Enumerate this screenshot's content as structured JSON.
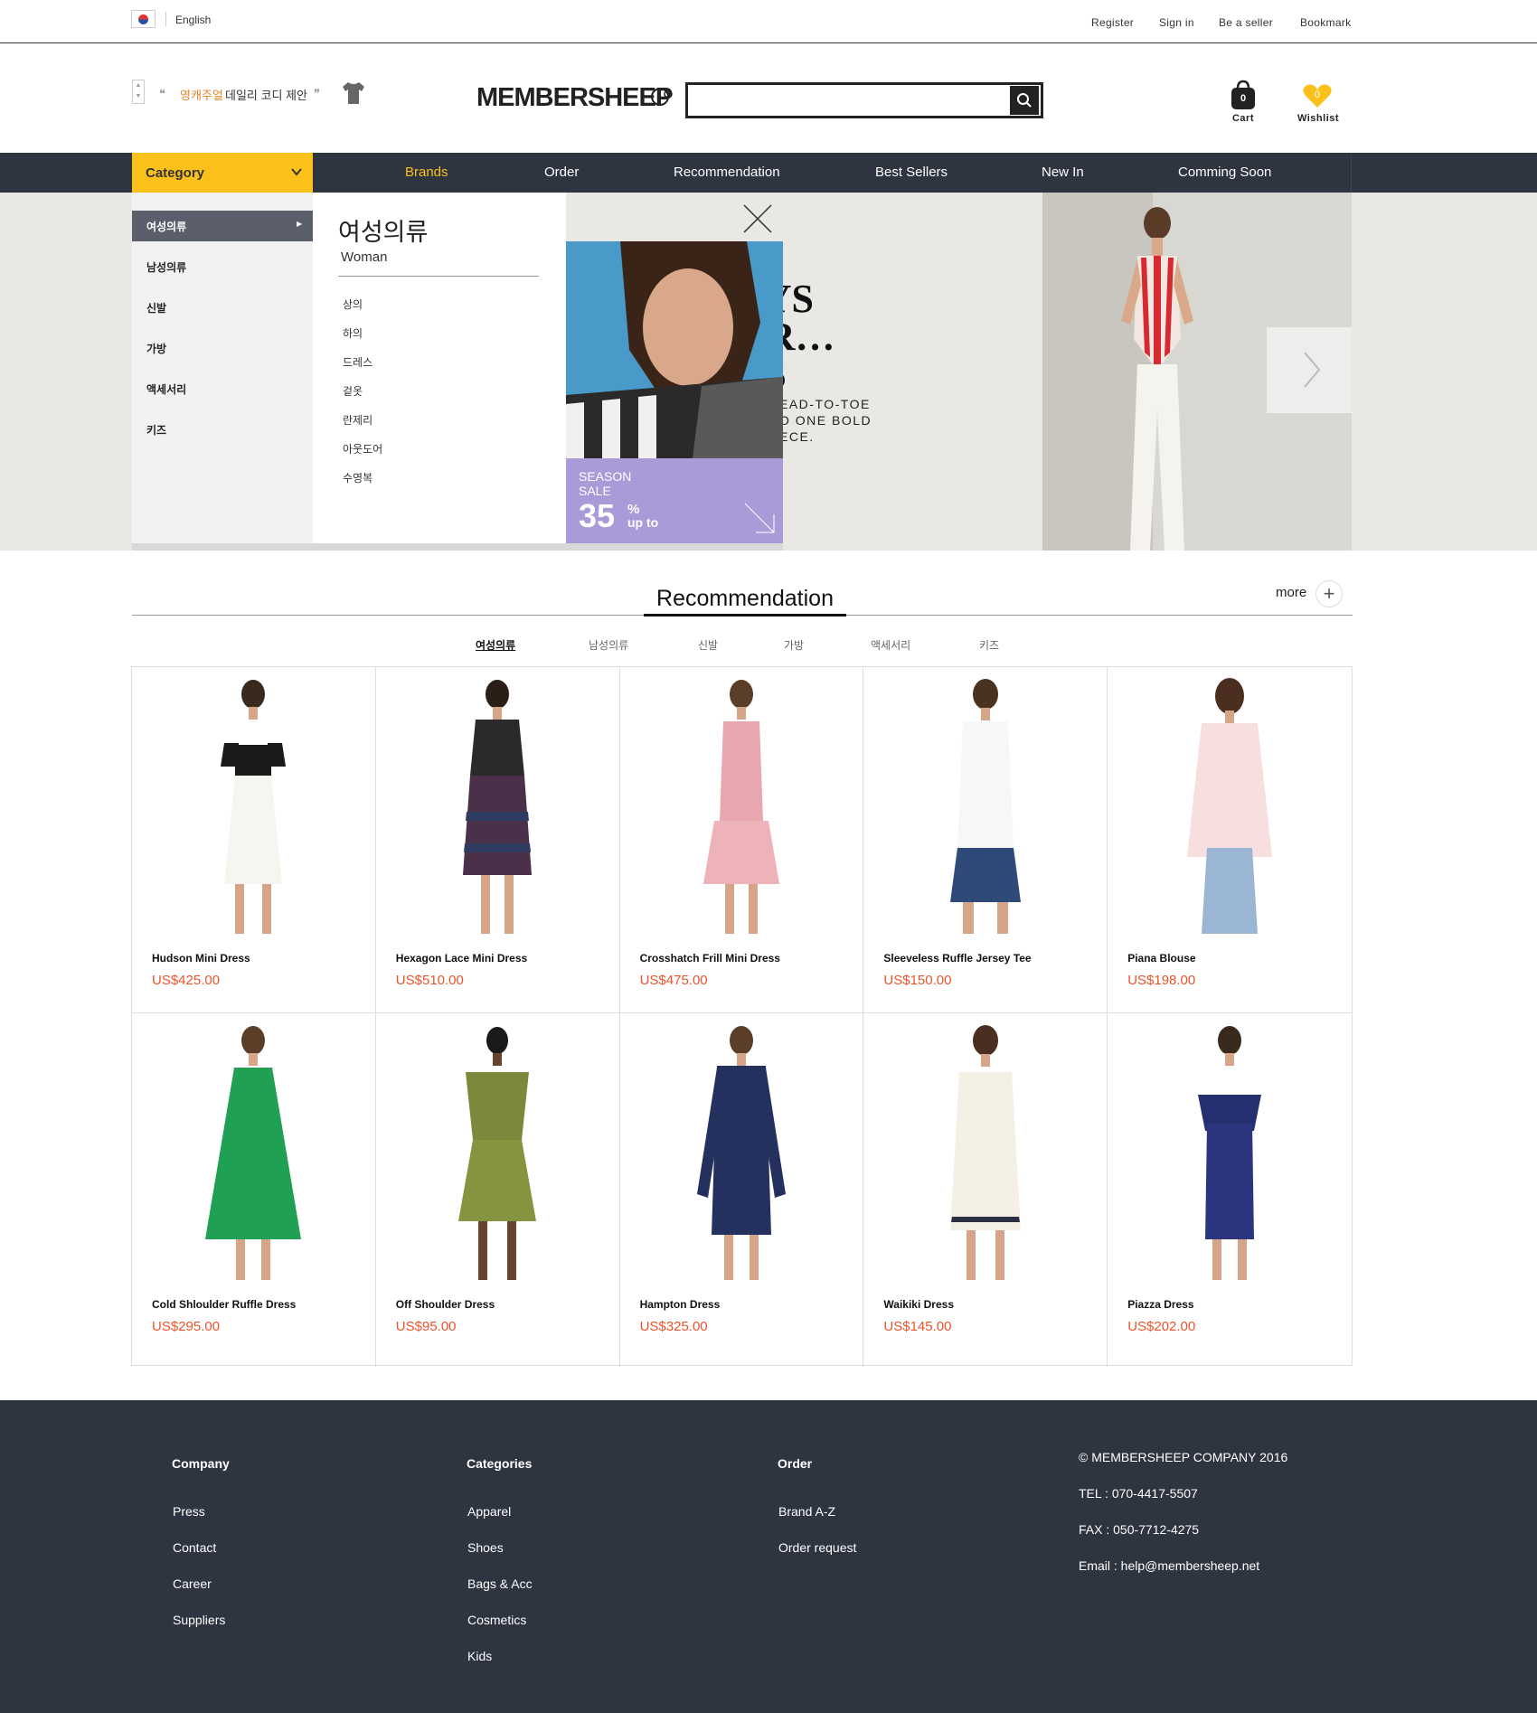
{
  "topbar": {
    "lang": "English",
    "links": [
      "Register",
      "Sign in",
      "Be a seller",
      "Bookmark"
    ]
  },
  "header": {
    "promo_brand": "영캐주얼",
    "promo_text": "데일리 코디 제안",
    "logo": "MEMBERSHEEP",
    "search_placeholder": "",
    "cart_count": "0",
    "cart_label": "Cart",
    "wish_count": "0",
    "wish_label": "Wishlist"
  },
  "nav": {
    "category": "Category",
    "items": [
      "Brands",
      "Order",
      "Recommendation",
      "Best Sellers",
      "New In",
      "Comming Soon"
    ],
    "active_color": "#fbc11a"
  },
  "hero": {
    "headline": [
      "AYS",
      "AR…",
      "ES"
    ],
    "sub": [
      "EAD-TO-TOE",
      "O ONE BOLD",
      "ECE."
    ]
  },
  "dropdown": {
    "categories": [
      "여성의류",
      "남성의류",
      "신발",
      "가방",
      "액세서리",
      "키즈"
    ],
    "title": "여성의류",
    "subtitle": "Woman",
    "subitems": [
      "상의",
      "하의",
      "드레스",
      "겉옷",
      "란제리",
      "아웃도어",
      "수영복"
    ],
    "ad": {
      "line1": "SEASON",
      "line2": "SALE",
      "number": "35",
      "pct": "%",
      "upto": "up to"
    }
  },
  "recommendation": {
    "title": "Recommendation",
    "more": "more",
    "tabs": [
      "여성의류",
      "남성의류",
      "신발",
      "가방",
      "액세서리",
      "키즈"
    ],
    "products": [
      {
        "name": "Hudson Mini Dress",
        "price": "US$425.00"
      },
      {
        "name": "Hexagon Lace Mini Dress",
        "price": "US$510.00"
      },
      {
        "name": "Crosshatch Frill Mini Dress",
        "price": "US$475.00"
      },
      {
        "name": "Sleeveless Ruffle Jersey Tee",
        "price": "US$150.00"
      },
      {
        "name": "Piana Blouse",
        "price": "US$198.00"
      },
      {
        "name": "Cold Shloulder Ruffle Dress",
        "price": "US$295.00"
      },
      {
        "name": "Off Shoulder Dress",
        "price": "US$95.00"
      },
      {
        "name": "Hampton Dress",
        "price": "US$325.00"
      },
      {
        "name": "Waikiki Dress",
        "price": "US$145.00"
      },
      {
        "name": "Piazza Dress",
        "price": "US$202.00"
      }
    ]
  },
  "footer": {
    "company": {
      "title": "Company",
      "links": [
        "Press",
        "Contact",
        "Career",
        "Suppliers"
      ]
    },
    "categories": {
      "title": "Categories",
      "links": [
        "Apparel",
        "Shoes",
        "Bags & Acc",
        "Cosmetics",
        "Kids"
      ]
    },
    "order": {
      "title": "Order",
      "links": [
        "Brand A-Z",
        "Order request"
      ]
    },
    "info": [
      "© MEMBERSHEEP COMPANY 2016",
      "TEL : 070-4417-5507",
      "FAX : 050-7712-4275",
      "Email : help@membersheep.net"
    ]
  }
}
